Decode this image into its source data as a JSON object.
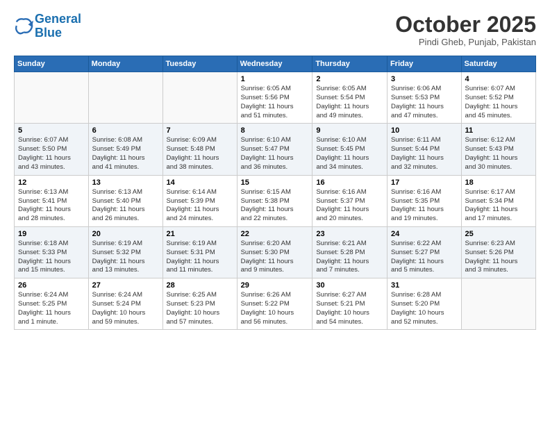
{
  "logo": {
    "line1": "General",
    "line2": "Blue"
  },
  "title": "October 2025",
  "subtitle": "Pindi Gheb, Punjab, Pakistan",
  "days_header": [
    "Sunday",
    "Monday",
    "Tuesday",
    "Wednesday",
    "Thursday",
    "Friday",
    "Saturday"
  ],
  "weeks": [
    [
      {
        "num": "",
        "info": ""
      },
      {
        "num": "",
        "info": ""
      },
      {
        "num": "",
        "info": ""
      },
      {
        "num": "1",
        "info": "Sunrise: 6:05 AM\nSunset: 5:56 PM\nDaylight: 11 hours\nand 51 minutes."
      },
      {
        "num": "2",
        "info": "Sunrise: 6:05 AM\nSunset: 5:54 PM\nDaylight: 11 hours\nand 49 minutes."
      },
      {
        "num": "3",
        "info": "Sunrise: 6:06 AM\nSunset: 5:53 PM\nDaylight: 11 hours\nand 47 minutes."
      },
      {
        "num": "4",
        "info": "Sunrise: 6:07 AM\nSunset: 5:52 PM\nDaylight: 11 hours\nand 45 minutes."
      }
    ],
    [
      {
        "num": "5",
        "info": "Sunrise: 6:07 AM\nSunset: 5:50 PM\nDaylight: 11 hours\nand 43 minutes."
      },
      {
        "num": "6",
        "info": "Sunrise: 6:08 AM\nSunset: 5:49 PM\nDaylight: 11 hours\nand 41 minutes."
      },
      {
        "num": "7",
        "info": "Sunrise: 6:09 AM\nSunset: 5:48 PM\nDaylight: 11 hours\nand 38 minutes."
      },
      {
        "num": "8",
        "info": "Sunrise: 6:10 AM\nSunset: 5:47 PM\nDaylight: 11 hours\nand 36 minutes."
      },
      {
        "num": "9",
        "info": "Sunrise: 6:10 AM\nSunset: 5:45 PM\nDaylight: 11 hours\nand 34 minutes."
      },
      {
        "num": "10",
        "info": "Sunrise: 6:11 AM\nSunset: 5:44 PM\nDaylight: 11 hours\nand 32 minutes."
      },
      {
        "num": "11",
        "info": "Sunrise: 6:12 AM\nSunset: 5:43 PM\nDaylight: 11 hours\nand 30 minutes."
      }
    ],
    [
      {
        "num": "12",
        "info": "Sunrise: 6:13 AM\nSunset: 5:41 PM\nDaylight: 11 hours\nand 28 minutes."
      },
      {
        "num": "13",
        "info": "Sunrise: 6:13 AM\nSunset: 5:40 PM\nDaylight: 11 hours\nand 26 minutes."
      },
      {
        "num": "14",
        "info": "Sunrise: 6:14 AM\nSunset: 5:39 PM\nDaylight: 11 hours\nand 24 minutes."
      },
      {
        "num": "15",
        "info": "Sunrise: 6:15 AM\nSunset: 5:38 PM\nDaylight: 11 hours\nand 22 minutes."
      },
      {
        "num": "16",
        "info": "Sunrise: 6:16 AM\nSunset: 5:37 PM\nDaylight: 11 hours\nand 20 minutes."
      },
      {
        "num": "17",
        "info": "Sunrise: 6:16 AM\nSunset: 5:35 PM\nDaylight: 11 hours\nand 19 minutes."
      },
      {
        "num": "18",
        "info": "Sunrise: 6:17 AM\nSunset: 5:34 PM\nDaylight: 11 hours\nand 17 minutes."
      }
    ],
    [
      {
        "num": "19",
        "info": "Sunrise: 6:18 AM\nSunset: 5:33 PM\nDaylight: 11 hours\nand 15 minutes."
      },
      {
        "num": "20",
        "info": "Sunrise: 6:19 AM\nSunset: 5:32 PM\nDaylight: 11 hours\nand 13 minutes."
      },
      {
        "num": "21",
        "info": "Sunrise: 6:19 AM\nSunset: 5:31 PM\nDaylight: 11 hours\nand 11 minutes."
      },
      {
        "num": "22",
        "info": "Sunrise: 6:20 AM\nSunset: 5:30 PM\nDaylight: 11 hours\nand 9 minutes."
      },
      {
        "num": "23",
        "info": "Sunrise: 6:21 AM\nSunset: 5:28 PM\nDaylight: 11 hours\nand 7 minutes."
      },
      {
        "num": "24",
        "info": "Sunrise: 6:22 AM\nSunset: 5:27 PM\nDaylight: 11 hours\nand 5 minutes."
      },
      {
        "num": "25",
        "info": "Sunrise: 6:23 AM\nSunset: 5:26 PM\nDaylight: 11 hours\nand 3 minutes."
      }
    ],
    [
      {
        "num": "26",
        "info": "Sunrise: 6:24 AM\nSunset: 5:25 PM\nDaylight: 11 hours\nand 1 minute."
      },
      {
        "num": "27",
        "info": "Sunrise: 6:24 AM\nSunset: 5:24 PM\nDaylight: 10 hours\nand 59 minutes."
      },
      {
        "num": "28",
        "info": "Sunrise: 6:25 AM\nSunset: 5:23 PM\nDaylight: 10 hours\nand 57 minutes."
      },
      {
        "num": "29",
        "info": "Sunrise: 6:26 AM\nSunset: 5:22 PM\nDaylight: 10 hours\nand 56 minutes."
      },
      {
        "num": "30",
        "info": "Sunrise: 6:27 AM\nSunset: 5:21 PM\nDaylight: 10 hours\nand 54 minutes."
      },
      {
        "num": "31",
        "info": "Sunrise: 6:28 AM\nSunset: 5:20 PM\nDaylight: 10 hours\nand 52 minutes."
      },
      {
        "num": "",
        "info": ""
      }
    ]
  ]
}
